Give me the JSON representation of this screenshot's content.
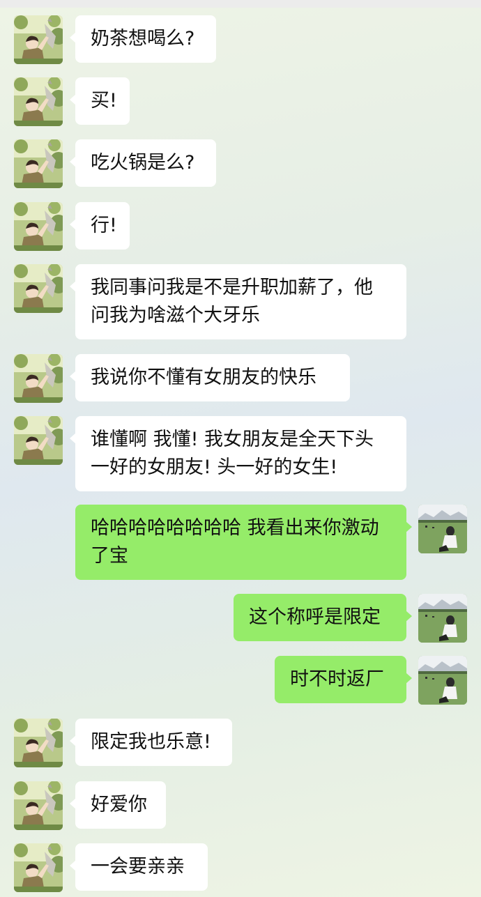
{
  "chat": {
    "messages": [
      {
        "sender": "friend",
        "avatar": "friend-avatar-anime-boy",
        "text": "奶茶想喝么?"
      },
      {
        "sender": "friend",
        "avatar": "friend-avatar-anime-boy",
        "text": "买!"
      },
      {
        "sender": "friend",
        "avatar": "friend-avatar-anime-boy",
        "text": "吃火锅是么?"
      },
      {
        "sender": "friend",
        "avatar": "friend-avatar-anime-boy",
        "text": "行!"
      },
      {
        "sender": "friend",
        "avatar": "friend-avatar-anime-boy",
        "text": "我同事问我是不是升职加薪了，他问我为啥滋个大牙乐"
      },
      {
        "sender": "friend",
        "avatar": "friend-avatar-anime-boy",
        "text": "我说你不懂有女朋友的快乐"
      },
      {
        "sender": "friend",
        "avatar": "friend-avatar-anime-boy",
        "text": "谁懂啊 我懂! 我女朋友是全天下头一好的女朋友! 头一好的女生!"
      },
      {
        "sender": "self",
        "avatar": "self-avatar-meadow-girl",
        "text": "哈哈哈哈哈哈哈哈 我看出来你激动了宝"
      },
      {
        "sender": "self",
        "avatar": "self-avatar-meadow-girl",
        "text": "这个称呼是限定"
      },
      {
        "sender": "self",
        "avatar": "self-avatar-meadow-girl",
        "text": "时不时返厂"
      },
      {
        "sender": "friend",
        "avatar": "friend-avatar-anime-boy",
        "text": "限定我也乐意!"
      },
      {
        "sender": "friend",
        "avatar": "friend-avatar-anime-boy",
        "text": "好爱你"
      },
      {
        "sender": "friend",
        "avatar": "friend-avatar-anime-boy",
        "text": "一会要亲亲"
      }
    ]
  },
  "colors": {
    "self_bubble": "#95ec69",
    "friend_bubble": "#ffffff",
    "text": "#111111"
  }
}
